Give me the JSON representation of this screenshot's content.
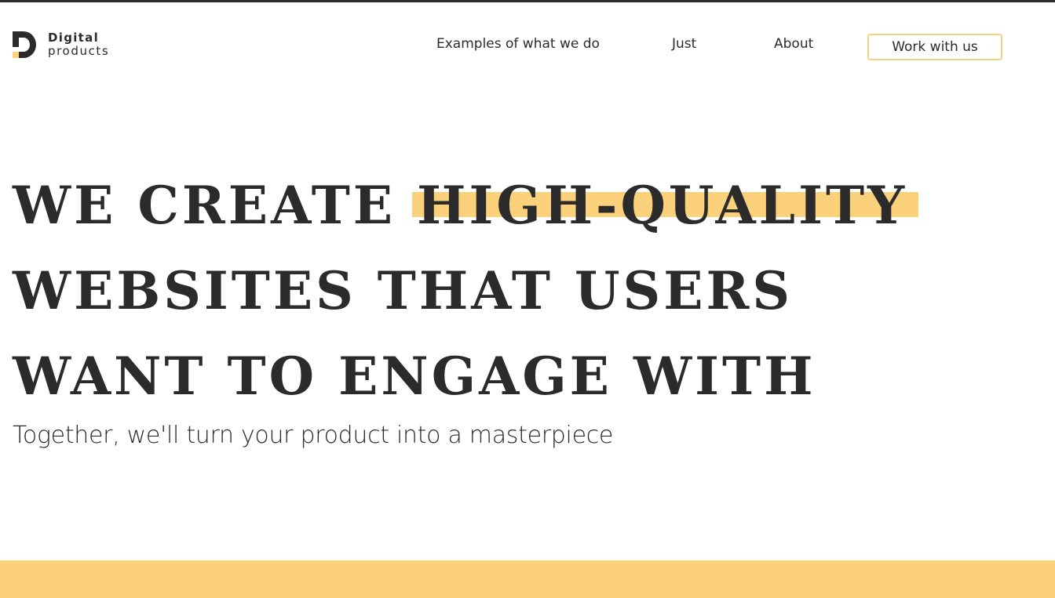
{
  "brand": {
    "line1": "Digital",
    "line2": "products",
    "accent": "#fbd27b",
    "ink": "#2b2b2b"
  },
  "nav": {
    "items": [
      "Examples of what we do",
      "Just",
      "About"
    ],
    "cta": "Work with us"
  },
  "hero": {
    "headline_pre": "We create ",
    "headline_highlight": "high-quality",
    "headline_line2": "websites that users",
    "headline_line3": "want to engage with",
    "subtitle": "Together, we'll turn your product into a masterpiece"
  }
}
